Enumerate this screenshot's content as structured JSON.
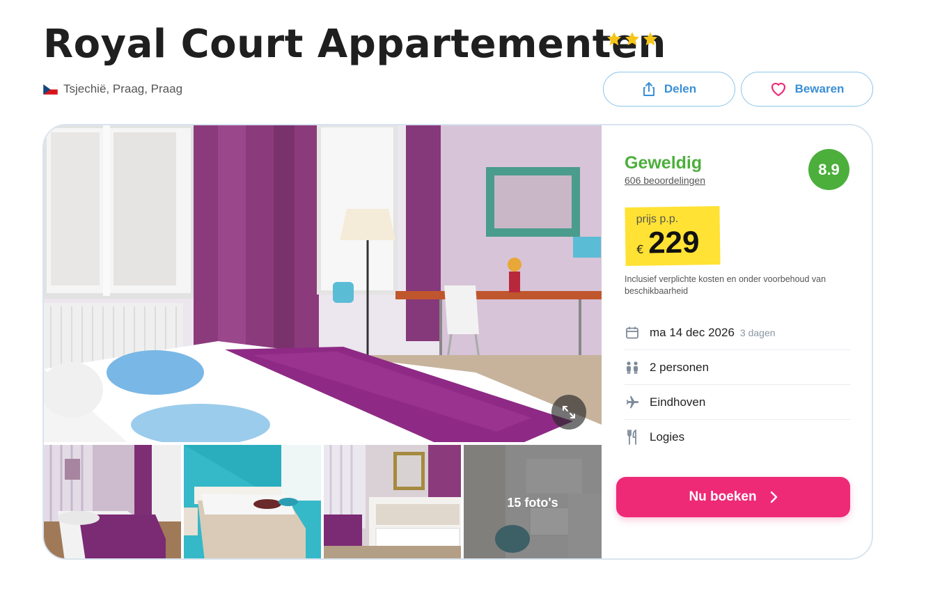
{
  "hotel": {
    "name": "Royal Court Appartementen",
    "stars": 3,
    "location": "Tsjechië, Praag, Praag",
    "flag_icon": "czech-flag-icon"
  },
  "actions": {
    "share_label": "Delen",
    "save_label": "Bewaren"
  },
  "gallery": {
    "more_photos_label": "15 foto's",
    "expand_icon": "expand-icon"
  },
  "rating": {
    "word": "Geweldig",
    "reviews": "606 beoordelingen",
    "score": "8.9"
  },
  "price": {
    "label": "prijs p.p.",
    "currency": "€",
    "value": "229",
    "note": "Inclusief verplichte kosten en onder voorbehoud van beschikbaarheid"
  },
  "details": {
    "date": "ma 14 dec 2026",
    "duration": "3 dagen",
    "persons": "2 personen",
    "departure": "Eindhoven",
    "board": "Logies"
  },
  "booking": {
    "button_label": "Nu boeken"
  },
  "colors": {
    "rating_green": "#4caf3c",
    "price_yellow": "#ffe233",
    "book_pink": "#ee2a77",
    "link_blue": "#3a8fd6",
    "star_yellow": "#f5c518"
  }
}
